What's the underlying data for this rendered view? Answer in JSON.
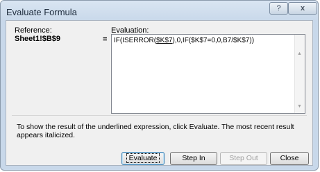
{
  "window": {
    "title": "Evaluate Formula",
    "help_glyph": "?",
    "close_glyph": "x"
  },
  "reference": {
    "label": "Reference:",
    "value": "Sheet1!$B$9"
  },
  "equals_sign": "=",
  "evaluation": {
    "label": "Evaluation:",
    "formula_prefix": "IF(ISERROR(",
    "formula_underlined": "$K$7",
    "formula_suffix": "),0,IF($K$7=0,0,B7/$K$7))"
  },
  "scroll": {
    "up_glyph": "▲",
    "down_glyph": "▼"
  },
  "info_text": "To show the result of the underlined expression, click Evaluate.  The most recent result appears italicized.",
  "buttons": {
    "evaluate": "Evaluate",
    "step_in": "Step In",
    "step_out": "Step Out",
    "close": "Close"
  }
}
